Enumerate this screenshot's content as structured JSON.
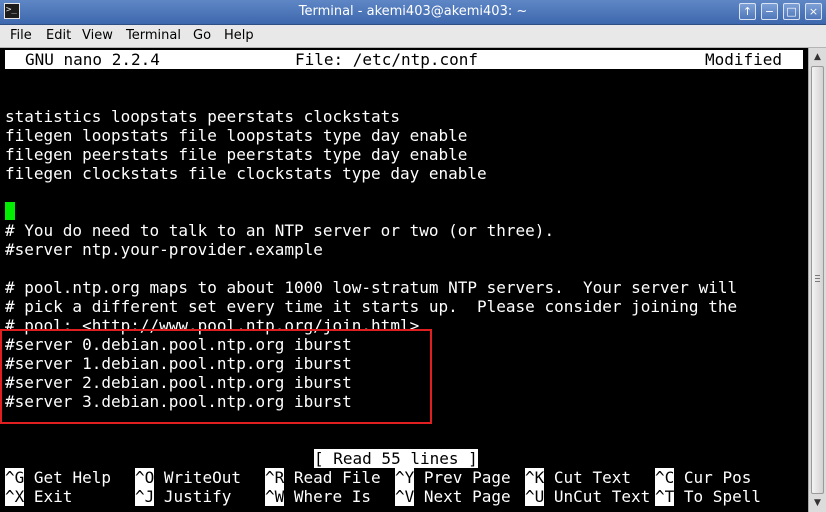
{
  "window": {
    "title": "Terminal - akemi403@akemi403: ~",
    "icon": "terminal-icon",
    "buttons": [
      "↑",
      "−",
      "□",
      "×"
    ]
  },
  "menubar": {
    "items": [
      "File",
      "Edit",
      "View",
      "Terminal",
      "Go",
      "Help"
    ]
  },
  "nano": {
    "version": "GNU nano 2.2.4",
    "file": "File: /etc/ntp.conf",
    "state": "Modified",
    "lines": [
      "statistics loopstats peerstats clockstats",
      "filegen loopstats file loopstats type day enable",
      "filegen peerstats file peerstats type day enable",
      "filegen clockstats file clockstats type day enable",
      "",
      "# You do need to talk to an NTP server or two (or three).",
      "#server ntp.your-provider.example",
      "",
      "# pool.ntp.org maps to about 1000 low-stratum NTP servers.  Your server will",
      "# pick a different set every time it starts up.  Please consider joining the",
      "# pool: <http://www.pool.ntp.org/join.html>",
      "#server 0.debian.pool.ntp.org iburst",
      "#server 1.debian.pool.ntp.org iburst",
      "#server 2.debian.pool.ntp.org iburst",
      "#server 3.debian.pool.ntp.org iburst"
    ],
    "status_message": "[ Read 55 lines ]",
    "shortcuts_row1": [
      {
        "key": "^G",
        "label": "Get Help"
      },
      {
        "key": "^O",
        "label": "WriteOut"
      },
      {
        "key": "^R",
        "label": "Read File"
      },
      {
        "key": "^Y",
        "label": "Prev Page"
      },
      {
        "key": "^K",
        "label": "Cut Text"
      },
      {
        "key": "^C",
        "label": "Cur Pos"
      }
    ],
    "shortcuts_row2": [
      {
        "key": "^X",
        "label": "Exit"
      },
      {
        "key": "^J",
        "label": "Justify"
      },
      {
        "key": "^W",
        "label": "Where Is"
      },
      {
        "key": "^V",
        "label": "Next Page"
      },
      {
        "key": "^U",
        "label": "UnCut Text"
      },
      {
        "key": "^T",
        "label": "To Spell"
      }
    ]
  },
  "colors": {
    "terminal_bg": "#000000",
    "cursor": "#00ee00",
    "highlight_box": "#e02020"
  }
}
